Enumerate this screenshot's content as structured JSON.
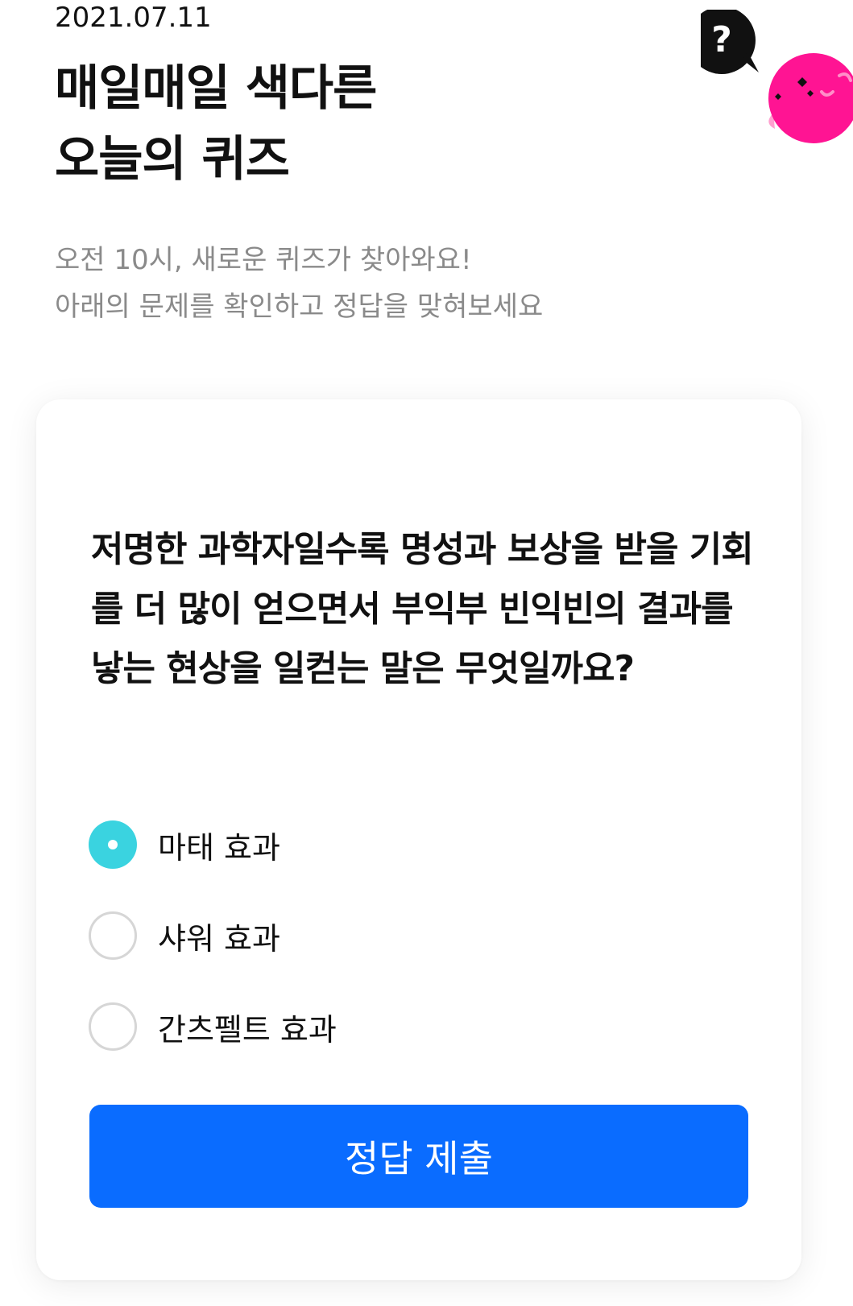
{
  "header": {
    "date": "2021.07.11",
    "title_line1": "매일매일 색다른",
    "title_line2": "오늘의 퀴즈",
    "subtitle_line1": "오전 10시, 새로운 퀴즈가 찾아와요!",
    "subtitle_line2": "아래의 문제를 확인하고 정답을 맞혀보세요"
  },
  "mascot": {
    "bubble_text": "?",
    "icon": "quiz-mascot",
    "bubble_color": "#111111",
    "character_color": "#ff1493"
  },
  "quiz": {
    "question": "저명한 과학자일수록 명성과 보상을 받을 기회를 더 많이 얻으면서 부익부 빈익빈의 결과를 낳는 현상을 일컫는 말은 무엇일까요?",
    "options": [
      {
        "label": "마태 효과",
        "selected": true
      },
      {
        "label": "샤워 효과",
        "selected": false
      },
      {
        "label": "간츠펠트 효과",
        "selected": false
      }
    ],
    "submit_label": "정답 제출"
  },
  "colors": {
    "accent": "#0a6cff",
    "selected_radio": "#3ad3e0",
    "subtitle": "#8a8a8a"
  }
}
